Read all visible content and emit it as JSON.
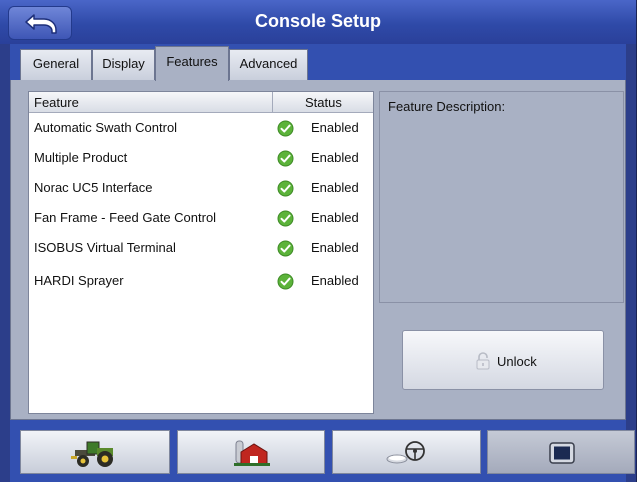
{
  "window": {
    "title": "Console Setup"
  },
  "tabs": [
    {
      "label": "General",
      "active": false
    },
    {
      "label": "Display",
      "active": false
    },
    {
      "label": "Features",
      "active": true
    },
    {
      "label": "Advanced",
      "active": false
    }
  ],
  "feature_table": {
    "columns": [
      "Feature",
      "Status"
    ],
    "rows": [
      {
        "feature": "Automatic Swath Control",
        "status": "Enabled",
        "icon": "green-check-icon"
      },
      {
        "feature": "Multiple Product",
        "status": "Enabled",
        "icon": "green-check-icon"
      },
      {
        "feature": "Norac UC5 Interface",
        "status": "Enabled",
        "icon": "green-check-icon"
      },
      {
        "feature": "Fan Frame - Feed Gate Control",
        "status": "Enabled",
        "icon": "green-check-icon"
      },
      {
        "feature": "ISOBUS Virtual Terminal",
        "status": "Enabled",
        "icon": "green-check-icon"
      },
      {
        "feature": "HARDI Sprayer",
        "status": "Enabled",
        "icon": "green-check-icon"
      }
    ]
  },
  "description": {
    "label": "Feature Description:"
  },
  "unlock_button": {
    "label": "Unlock",
    "icon": "padlock-icon"
  },
  "bottom_nav": [
    {
      "icon": "tractor-icon",
      "selected": false
    },
    {
      "icon": "farm-barn-icon",
      "selected": false
    },
    {
      "icon": "gps-steering-icon",
      "selected": false
    },
    {
      "icon": "display-monitor-icon",
      "selected": true
    }
  ],
  "colors": {
    "title_bar": "#2f4aa8",
    "panel": "#a9b1c4",
    "enabled_check": "#5cb33a"
  }
}
